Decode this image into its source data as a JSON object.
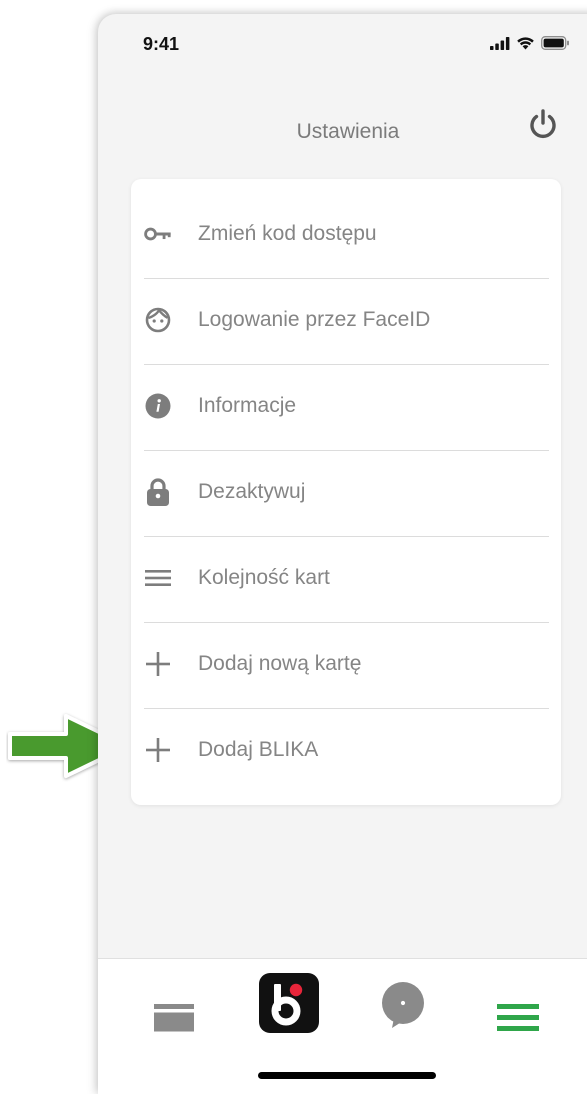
{
  "status_bar": {
    "time": "9:41"
  },
  "header": {
    "title": "Ustawienia",
    "power_icon": "power-icon"
  },
  "menu": {
    "items": [
      {
        "label": "Zmień kod dostępu",
        "icon": "key-icon"
      },
      {
        "label": "Logowanie przez FaceID",
        "icon": "face-icon"
      },
      {
        "label": "Informacje",
        "icon": "info-icon"
      },
      {
        "label": "Dezaktywuj",
        "icon": "lock-icon"
      },
      {
        "label": "Kolejność kart",
        "icon": "reorder-icon"
      },
      {
        "label": "Dodaj nową kartę",
        "icon": "plus-icon"
      },
      {
        "label": "Dodaj BLIKA",
        "icon": "plus-icon"
      }
    ]
  },
  "tabbar": {
    "tabs": [
      {
        "name": "cards",
        "icon": "card-icon",
        "active": false
      },
      {
        "name": "blik",
        "icon": "blik-logo-icon",
        "active": false
      },
      {
        "name": "chat",
        "icon": "chat-icon",
        "active": false
      },
      {
        "name": "menu",
        "icon": "menu-icon",
        "active": true
      }
    ]
  },
  "colors": {
    "accent_green": "#2fa64a",
    "arrow_green": "#4a9a2e",
    "icon_gray": "#7d7d7d",
    "blik_red": "#e8253a"
  }
}
